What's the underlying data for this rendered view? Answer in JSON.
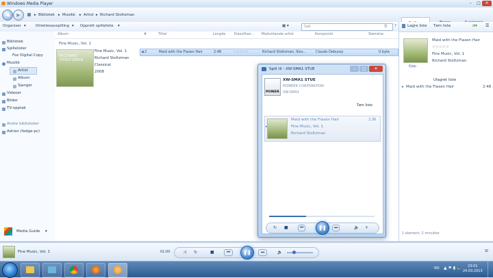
{
  "window": {
    "title": "Windows Media Player"
  },
  "nav": {
    "crumbs": [
      "Bibliotek",
      "Musikk",
      "Artist",
      "Richard Stoltzman"
    ],
    "separator": "▸"
  },
  "tabs": {
    "play": "Spill av",
    "burn": "Brenn",
    "sync": "Synkronis..."
  },
  "toolbar": {
    "organize": "Organiser",
    "stream": "Direktesavspilling",
    "create_playlist": "Opprett spilleliste",
    "search_placeholder": "Søk"
  },
  "sidebar": {
    "items": [
      {
        "label": "Bibliotek"
      },
      {
        "label": "Spillelister"
      },
      {
        "label": "Fox Digital Copy"
      },
      {
        "label": "Musikk"
      },
      {
        "label": "Artist"
      },
      {
        "label": "Album"
      },
      {
        "label": "Sjanger"
      },
      {
        "label": "Videoer"
      },
      {
        "label": "Bilder"
      },
      {
        "label": "TV-opptak"
      },
      {
        "label": "Andre biblioteker"
      },
      {
        "label": "Adrian (fedge-pc)"
      }
    ],
    "media_guide": "Media Guide"
  },
  "content": {
    "columns": [
      "Album",
      "#",
      "Tittel",
      "Lengde",
      "Klassifiser...",
      "Medvirkende artist",
      "Komponist",
      "Størrelse"
    ],
    "album_group": "Fine Music, Vol. 1",
    "album_cover_text": "RICHARD STOLTZMAN",
    "album_info": [
      "Fine Music, Vol. 1",
      "Richard Stoltzman",
      "Classical",
      "2008"
    ],
    "track": {
      "number": "2",
      "title": "Maid with the Flaxen Hair",
      "length": "2:48",
      "rating": "☆☆☆☆☆",
      "artist": "Richard Stoltzman; Slov...",
      "composer": "Claude Debussy",
      "size": "0 byte"
    }
  },
  "right_panel": {
    "save_list": "Lagre liste",
    "clear_list": "Tøm liste",
    "now_title": "Maid with the Flaxen Hair",
    "now_rating": "☆☆☆☆☆",
    "now_album": "Fine Music, Vol. 1",
    "now_artist": "Richard Stoltzman",
    "thumb_label": "Kjøp",
    "list_title": "Ulagret liste",
    "list_items": [
      {
        "title": "Maid with the Flaxen Hair",
        "length": "2:48"
      }
    ],
    "footer": "1 element, 2 minutter"
  },
  "dialog": {
    "title": "Spill til - XW-SMA1 STUE",
    "device_name": "XW-SMA1 STUE",
    "device_maker": "PIONEER CORPORATION",
    "device_model": "XW-SMA1",
    "logo_text": "PIONEER",
    "clear_list": "Tøm liste",
    "track_title": "Maid with the Flaxen Hair",
    "track_album": "Fine Music, Vol. 1",
    "track_artist": "Richard Stoltzman",
    "track_length": "2:36",
    "progress_fraction": 0.35
  },
  "player": {
    "now_playing": "Fine Music, Vol. 1",
    "elapsed": "01:00",
    "progress_fraction": 0.0
  },
  "taskbar": {
    "lang": "NO",
    "time": "23:01",
    "date": "24.03.2013"
  },
  "icons": {
    "back": "◀",
    "forward": "▶",
    "pause": "❚❚",
    "prev": "⏮",
    "next": "⏭",
    "stop": "■",
    "repeat": "↻",
    "shuffle": "⤨",
    "volume": "🔈"
  }
}
